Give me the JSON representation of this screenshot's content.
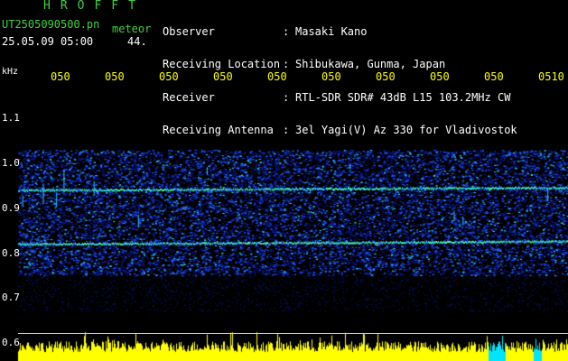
{
  "header": {
    "app_title": "HROFFT",
    "file_name": "UT2505090500.pn",
    "file_tag": "meteor",
    "timestamp": "25.05.09 05:00",
    "counter": "44."
  },
  "station_info": [
    {
      "label": "Observer",
      "value": "Masaki Kano"
    },
    {
      "label": "Receiving Location",
      "value": "Shibukawa, Gunma, Japan"
    },
    {
      "label": "Receiver",
      "value": "RTL-SDR SDR# 43dB L15 103.2MHz CW"
    },
    {
      "label": "Receiving Antenna",
      "value": "3el Yagi(V) Az 330 for Vladivostok"
    }
  ],
  "info_separator": ":",
  "time_axis": {
    "ticks": [
      "050",
      "050",
      "050",
      "050",
      "050",
      "050",
      "050",
      "050",
      "050",
      "0510"
    ]
  },
  "freq_axis": {
    "unit": "kHz",
    "ticks": [
      "1.1",
      "1.0",
      "0.9",
      "0.8",
      "0.7",
      "0.6"
    ]
  },
  "spectrogram": {
    "echo_lines_khz": [
      0.94,
      0.82
    ],
    "noise_band_khz": [
      1.02,
      0.76
    ],
    "colors": {
      "background": "#000000",
      "noise_low": "#0a1a8c",
      "noise_mid": "#1e5aff",
      "noise_high": "#32c8ff",
      "echo": "#40ffb0",
      "echo_peak": "#ff4040",
      "amplitude": "#ffff00",
      "amplitude_alt": "#00e5ff",
      "baseline": "#cfcfcf"
    }
  }
}
